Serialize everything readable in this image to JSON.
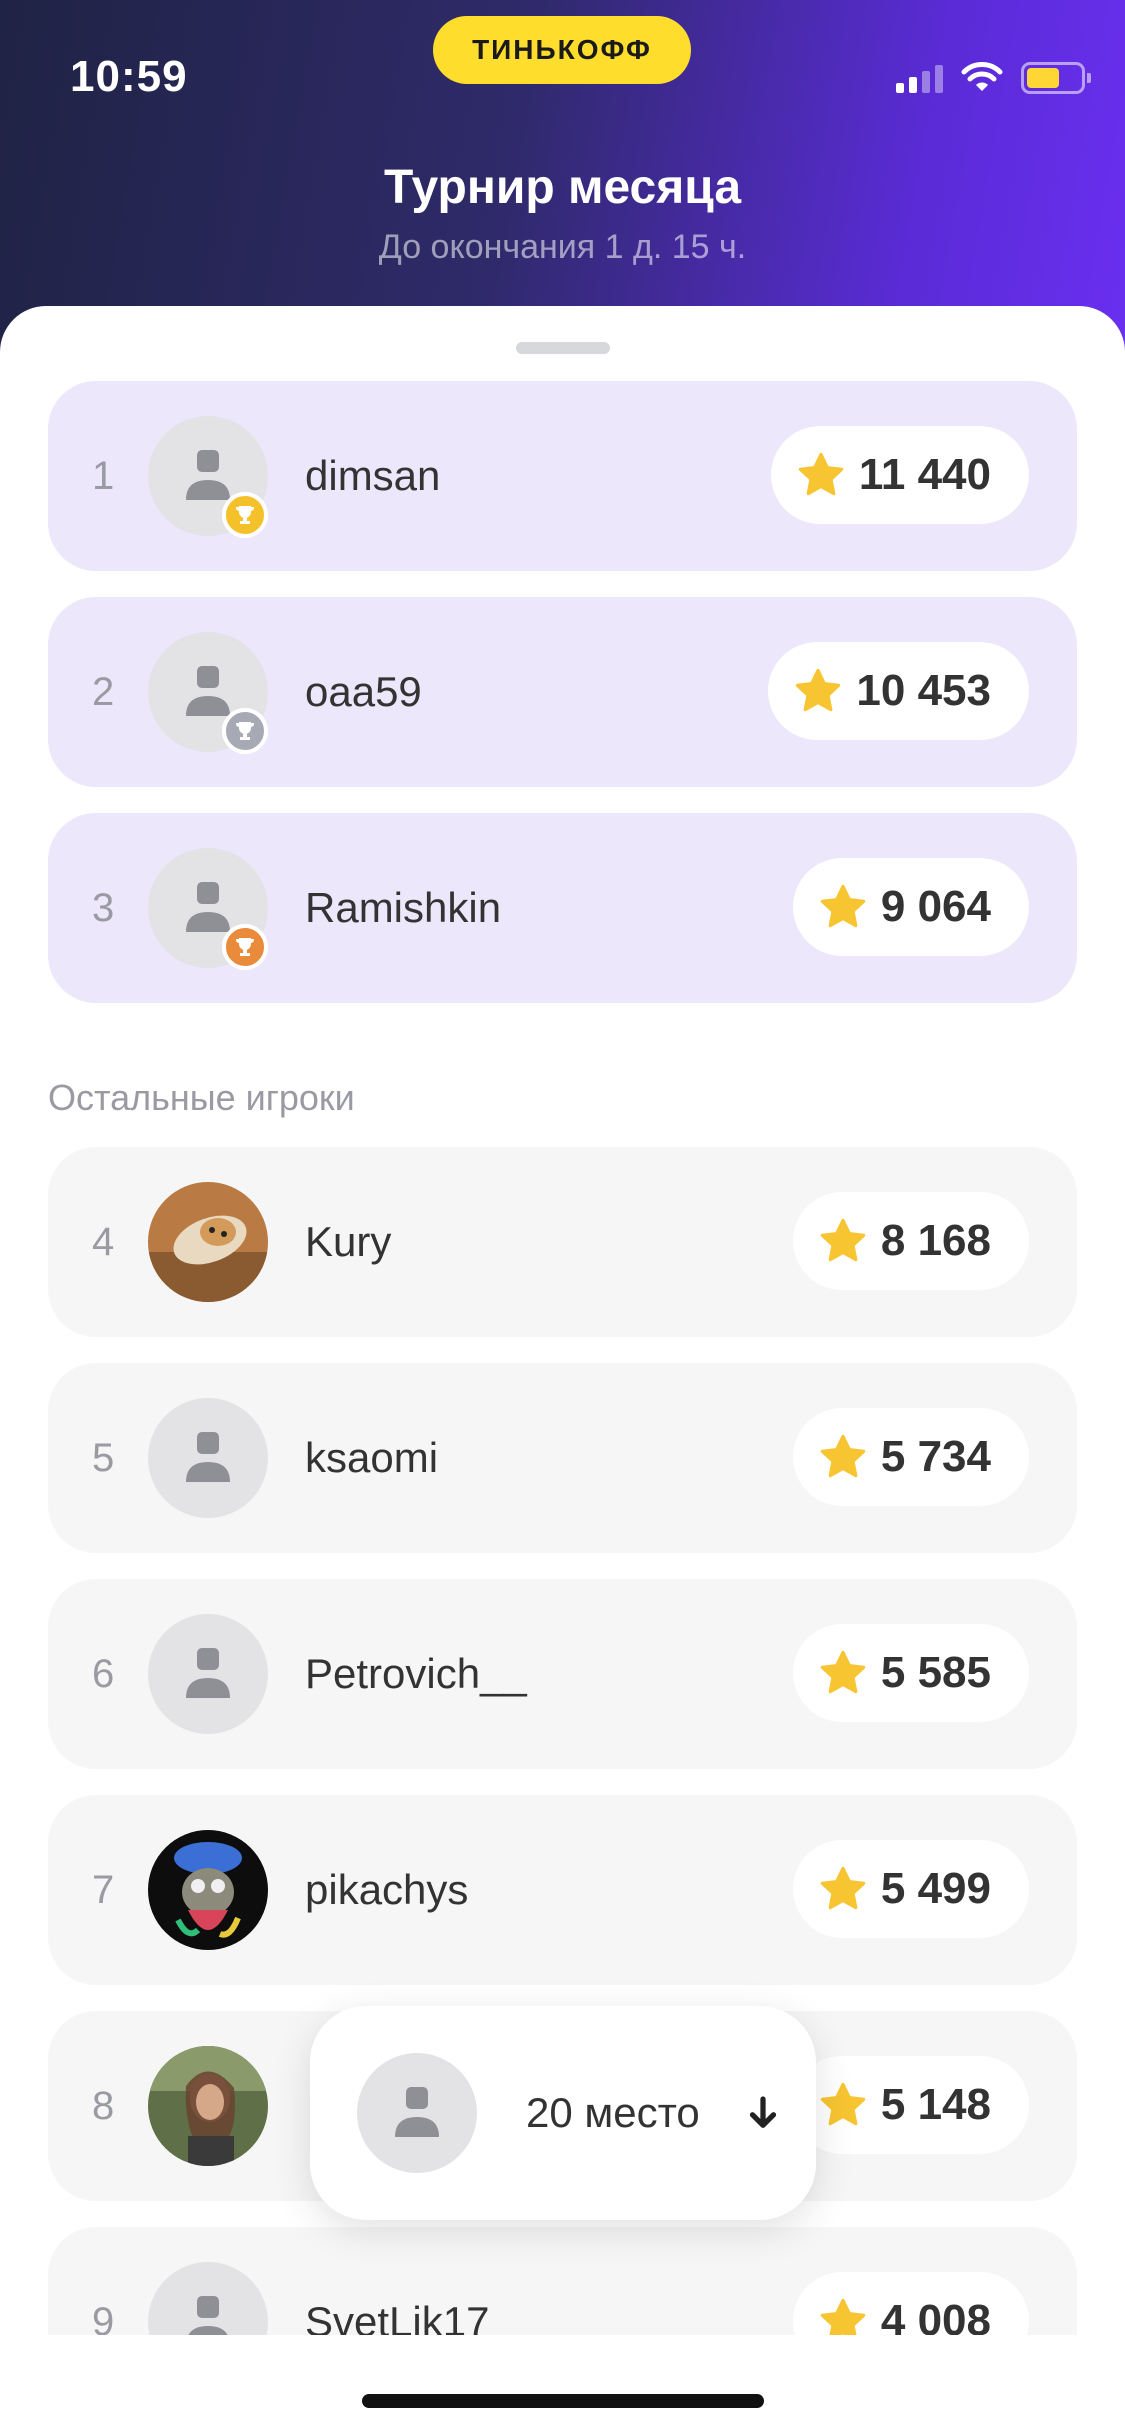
{
  "status_bar": {
    "time": "10:59"
  },
  "brand": {
    "label": "ТИНЬКОФФ",
    "color": "#ffdd2d"
  },
  "header": {
    "title": "Турнир месяца",
    "subtitle": "До окончания 1 д. 15 ч."
  },
  "top_players": [
    {
      "rank": "1",
      "name": "dimsan",
      "score": "11 440",
      "medal": "gold"
    },
    {
      "rank": "2",
      "name": "oaa59",
      "score": "10 453",
      "medal": "silver"
    },
    {
      "rank": "3",
      "name": "Ramishkin",
      "score": "9 064",
      "medal": "bronze"
    }
  ],
  "others_label": "Остальные игроки",
  "players": [
    {
      "rank": "4",
      "name": "Kury",
      "score": "8 168",
      "avatar": "photo-dog"
    },
    {
      "rank": "5",
      "name": "ksaomi",
      "score": "5 734",
      "avatar": "placeholder"
    },
    {
      "rank": "6",
      "name": "Petrovich__",
      "score": "5 585",
      "avatar": "placeholder"
    },
    {
      "rank": "7",
      "name": "pikachys",
      "score": "5 499",
      "avatar": "photo-art"
    },
    {
      "rank": "8",
      "name": "",
      "score": "5 148",
      "avatar": "photo-woman"
    },
    {
      "rank": "9",
      "name": "SvetLik17",
      "score": "4 008",
      "avatar": "placeholder"
    }
  ],
  "my_position": {
    "label": "20 место"
  },
  "icons": {
    "score": "star-icon",
    "medal": "trophy-icon",
    "avatar": "person-icon",
    "scroll": "arrow-down-icon"
  },
  "colors": {
    "header_gradient_start": "#1f2344",
    "header_gradient_end": "#6a2ff0",
    "top_row_bg": "#ece7fb",
    "row_bg": "#f6f6f7",
    "star": "#f7c531"
  }
}
